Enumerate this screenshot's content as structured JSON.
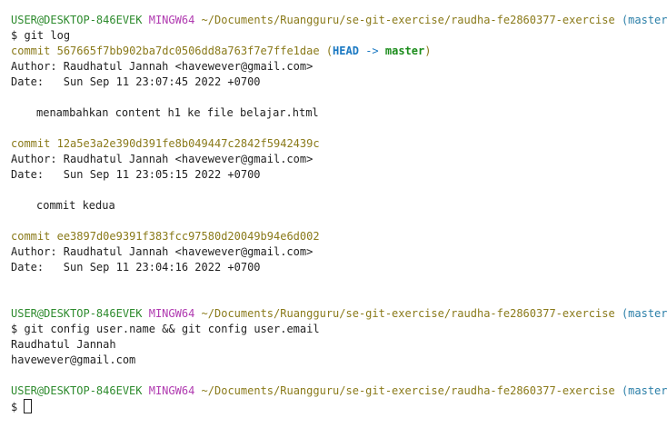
{
  "prompt": {
    "user_host": "USER@DESKTOP-846EVEK",
    "shell": "MINGW64",
    "path": "~/Documents/Ruangguru/se-git-exercise/raudha-fe2860377-exercise",
    "branch": "(master)",
    "symbol": "$"
  },
  "commands": {
    "git_log": "git log",
    "git_config": "git config user.name && git config user.email"
  },
  "log": [
    {
      "commit_label": "commit",
      "hash": "567665f7bb902ba7dc0506dd8a763f7e7ffe1dae",
      "ref_open": "(",
      "head": "HEAD",
      "arrow": "->",
      "branch": "master",
      "ref_close": ")",
      "author": "Author: Raudhatul Jannah <havewever@gmail.com>",
      "date": "Date:   Sun Sep 11 23:07:45 2022 +0700",
      "message": "menambahkan content h1 ke file belajar.html"
    },
    {
      "commit_label": "commit",
      "hash": "12a5e3a2e390d391fe8b049447c2842f5942439c",
      "author": "Author: Raudhatul Jannah <havewever@gmail.com>",
      "date": "Date:   Sun Sep 11 23:05:15 2022 +0700",
      "message": "commit kedua"
    },
    {
      "commit_label": "commit",
      "hash": "ee3897d0e9391f383fcc97580d20049b94e6d002",
      "author": "Author: Raudhatul Jannah <havewever@gmail.com>",
      "date": "Date:   Sun Sep 11 23:04:16 2022 +0700"
    }
  ],
  "config_output": {
    "name": "Raudhatul Jannah",
    "email": "havewever@gmail.com"
  },
  "colors": {
    "user_host": "#2e8b2e",
    "shell": "#b03ab0",
    "path": "#8a7a1a",
    "branch": "#2b7fa8",
    "head": "#1a78c2",
    "master": "#1b8c1b"
  }
}
